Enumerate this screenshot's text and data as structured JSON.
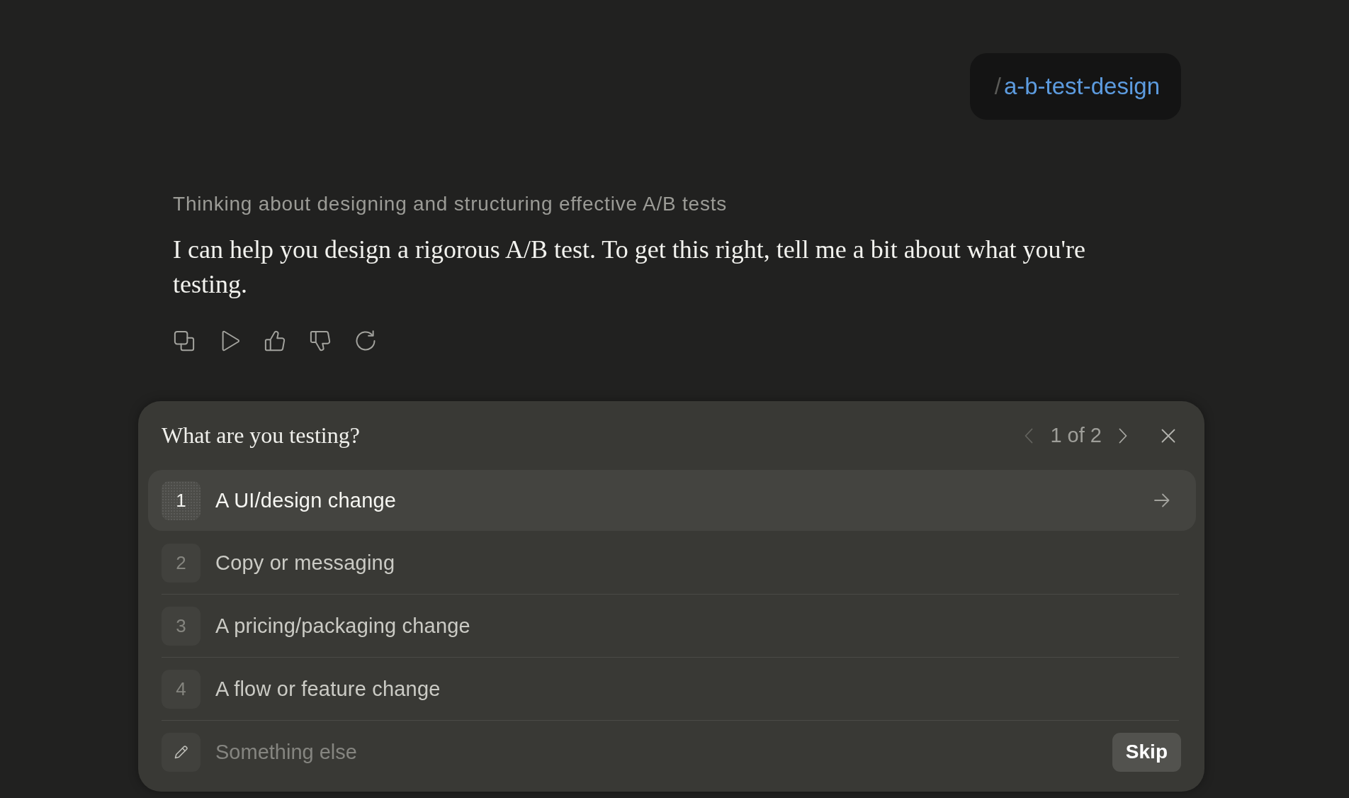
{
  "user_message": {
    "prefix": "/",
    "command": "a-b-test-design"
  },
  "thinking": {
    "summary": "Thinking about designing and structuring effective A/B tests"
  },
  "response": {
    "text": "I can help you design a rigorous A/B test. To get this right, tell me a bit about what you're testing."
  },
  "question": {
    "title": "What are you testing?",
    "pager": {
      "label": "1 of 2",
      "prev_disabled": true,
      "next_disabled": false
    },
    "options": [
      {
        "number": "1",
        "label": "A UI/design change",
        "selected": true
      },
      {
        "number": "2",
        "label": "Copy or messaging",
        "selected": false
      },
      {
        "number": "3",
        "label": "A pricing/packaging change",
        "selected": false
      },
      {
        "number": "4",
        "label": "A flow or feature change",
        "selected": false
      }
    ],
    "other": {
      "placeholder": "Something else"
    },
    "skip": "Skip"
  }
}
